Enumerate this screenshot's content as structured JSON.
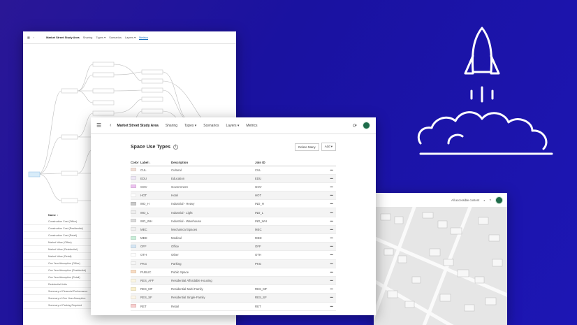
{
  "back_panel": {
    "title": "Market Street Study Area",
    "menu": [
      "Sharing",
      "Types ▾",
      "Scenarios",
      "Layers ▾",
      "Metrics"
    ],
    "list_header": "Name ↓",
    "list_items": [
      "Construction Cost (Office)",
      "Construction Cost (Residential)",
      "Construction Cost (Retail)",
      "Market Value (Office)",
      "Market Value (Residential)",
      "Market Value (Retail)",
      "One Year Absorption (Office)",
      "One Year Absorption (Residential)",
      "One Year Absorption (Retail)",
      "Residential Units",
      "Summary of Financial Performance",
      "Summary of One Year Absorption",
      "Summary of Parking Required"
    ]
  },
  "map_panel": {
    "content_filter": "All accessible content"
  },
  "main_panel": {
    "title": "Market Street Study Area",
    "menu": {
      "sharing": "Sharing",
      "types": "Types ▾",
      "scenarios": "Scenarios",
      "layers": "Layers ▾",
      "metrics": "Metrics"
    },
    "section_title": "Space Use Types",
    "delete_many": "Delete Many",
    "add": "Add ▾",
    "columns": {
      "color": "Color",
      "label": "Label ↓",
      "description": "Description",
      "join_id": "Join ID"
    },
    "rows": [
      {
        "color": "#f3e1d9",
        "label": "CUL",
        "description": "Cultural",
        "join": "CUL"
      },
      {
        "color": "#ede6f5",
        "label": "EDU",
        "description": "Education",
        "join": "EDU"
      },
      {
        "color": "#ecc2ef",
        "label": "GOV",
        "description": "Government",
        "join": "GOV"
      },
      {
        "color": "#ffffff",
        "label": "HOT",
        "description": "Hotel",
        "join": "HOT"
      },
      {
        "color": "#c8c8c8",
        "label": "IND_H",
        "description": "Industrial - Heavy",
        "join": "IND_H"
      },
      {
        "color": "#ededed",
        "label": "IND_L",
        "description": "Industrial - Light",
        "join": "IND_L"
      },
      {
        "color": "#dcdcdc",
        "label": "IND_WH",
        "description": "Industrial - Warehouse",
        "join": "IND_WH"
      },
      {
        "color": "#f0f0f0",
        "label": "MEC",
        "description": "Mechanical Spaces",
        "join": "MEC"
      },
      {
        "color": "#c9eed9",
        "label": "MED",
        "description": "Medical",
        "join": "MED"
      },
      {
        "color": "#d5e6f4",
        "label": "OFF",
        "description": "Office",
        "join": "OFF"
      },
      {
        "color": "#ffffff",
        "label": "OTH",
        "description": "Other",
        "join": "OTH"
      },
      {
        "color": "#f6f6f6",
        "label": "PKG",
        "description": "Parking",
        "join": "PKG"
      },
      {
        "color": "#f9ddc4",
        "label": "PUBLIC",
        "description": "Public Space",
        "join": ""
      },
      {
        "color": "#fcf7e4",
        "label": "RES_AFF",
        "description": "Residential Affordable Housing",
        "join": ""
      },
      {
        "color": "#faf0cc",
        "label": "RES_MF",
        "description": "Residential Multi-Family",
        "join": "RES_MF"
      },
      {
        "color": "#fdf7ea",
        "label": "RES_SF",
        "description": "Residential Single-Family",
        "join": "RES_SF"
      },
      {
        "color": "#f8cdcd",
        "label": "RET",
        "description": "Retail",
        "join": "RET"
      }
    ]
  }
}
